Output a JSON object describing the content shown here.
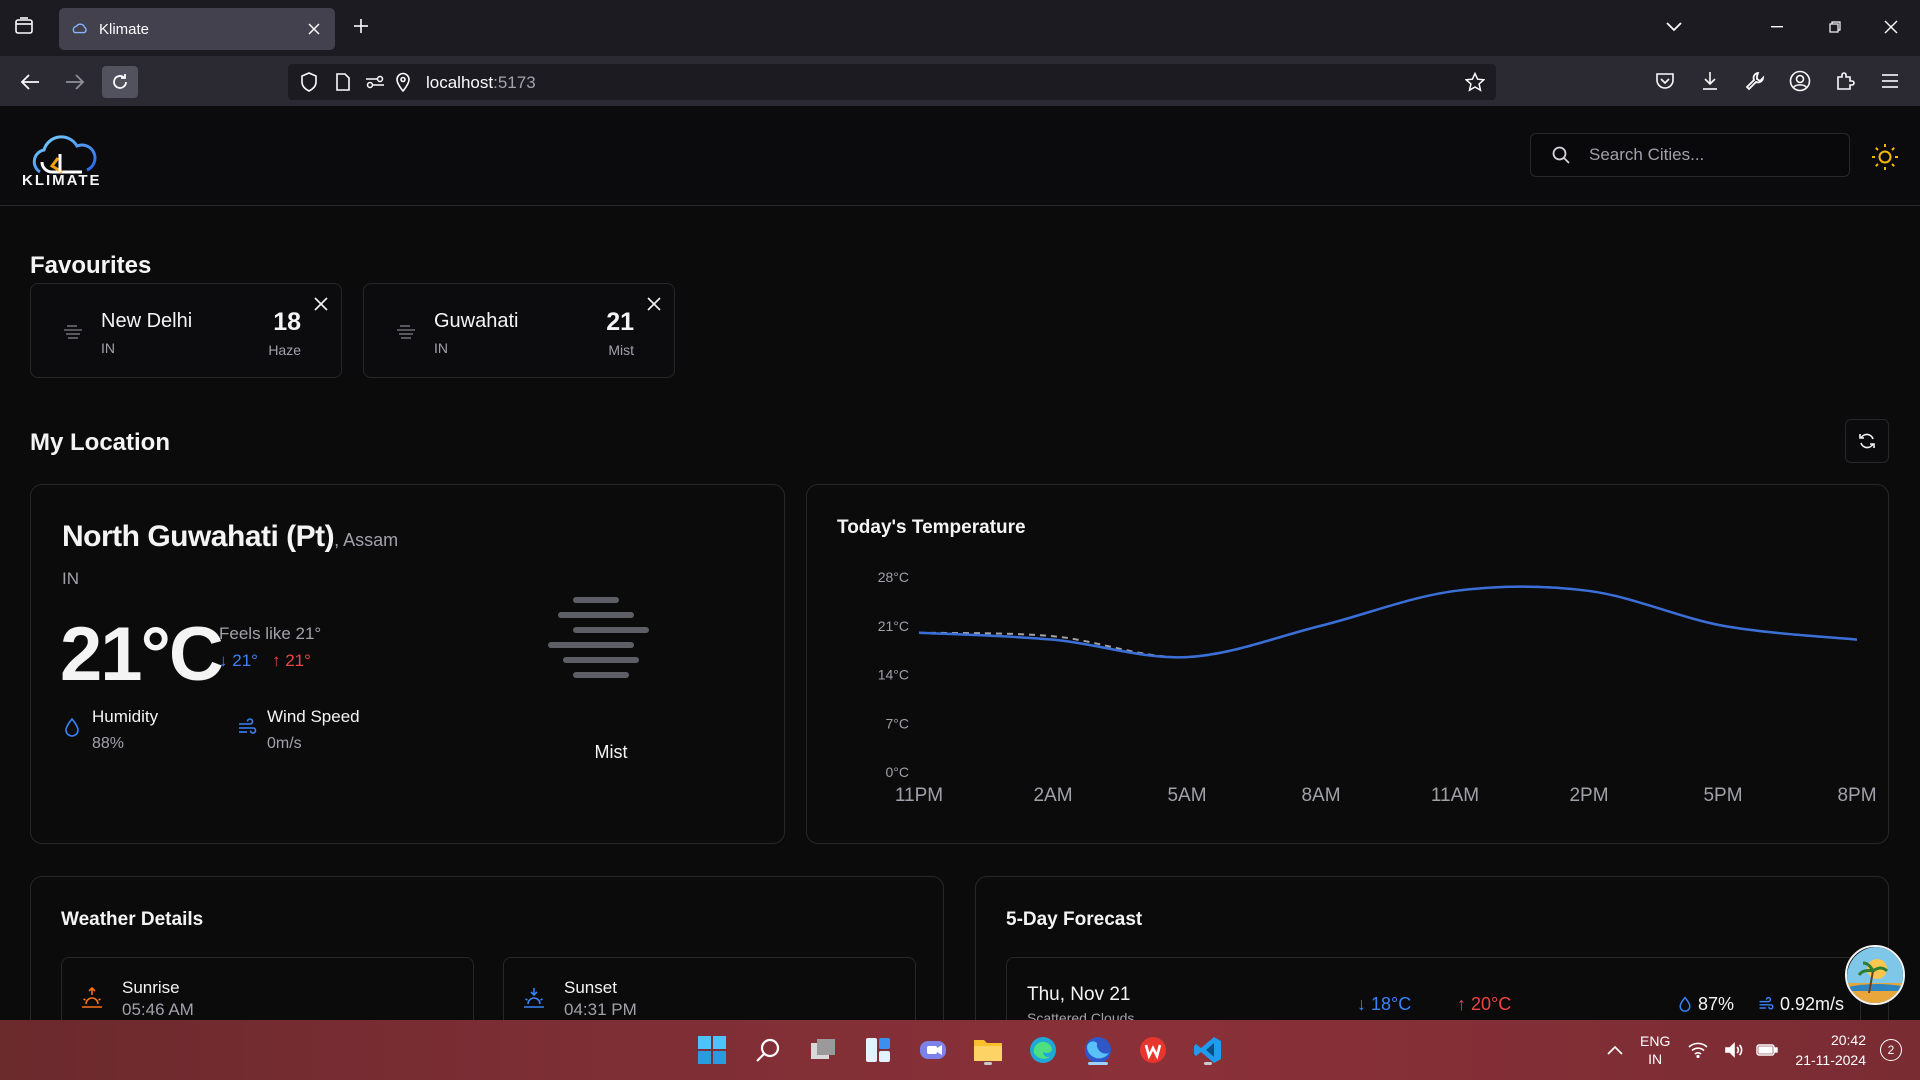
{
  "browser": {
    "tab_title": "Klimate",
    "url_host": "localhost",
    "url_port": ":5173"
  },
  "header": {
    "logo_text": "KLIMATE",
    "search_placeholder": "Search Cities..."
  },
  "favourites": {
    "title": "Favourites",
    "items": [
      {
        "name": "New Delhi",
        "country": "IN",
        "temp": "18",
        "desc": "Haze"
      },
      {
        "name": "Guwahati",
        "country": "IN",
        "temp": "21",
        "desc": "Mist"
      }
    ]
  },
  "location": {
    "title": "My Location",
    "city": "North Guwahati (Pt)",
    "state": ", Assam",
    "country": "IN",
    "temp": "21°C",
    "feels_like": "Feels like 21°",
    "min": "21°",
    "max": "21°",
    "humidity_label": "Humidity",
    "humidity_value": "88%",
    "wind_label": "Wind Speed",
    "wind_value": "0m/s",
    "condition": "Mist"
  },
  "chart_data": {
    "type": "line",
    "title": "Today's Temperature",
    "x": [
      "11PM",
      "2AM",
      "5AM",
      "8AM",
      "11AM",
      "2PM",
      "5PM",
      "8PM"
    ],
    "y_ticks": [
      "28°C",
      "21°C",
      "14°C",
      "7°C",
      "0°C"
    ],
    "ylim": [
      0,
      28
    ],
    "series": [
      {
        "values": [
          20,
          19,
          16.5,
          21,
          26,
          26,
          21,
          19
        ],
        "style": "solid",
        "color": "#3b6fd8"
      },
      {
        "values": [
          20,
          19.5,
          16.5,
          21,
          26,
          26,
          21,
          19
        ],
        "style": "dashed",
        "color": "#a1a1aa"
      }
    ]
  },
  "details": {
    "title": "Weather Details",
    "sunrise_label": "Sunrise",
    "sunrise_value": "05:46 AM",
    "sunset_label": "Sunset",
    "sunset_value": "04:31 PM"
  },
  "forecast": {
    "title": "5-Day Forecast",
    "rows": [
      {
        "date": "Thu, Nov 21",
        "desc": "Scattered Clouds",
        "min": "18°C",
        "max": "20°C",
        "humidity": "87%",
        "wind": "0.92m/s"
      }
    ]
  },
  "taskbar": {
    "lang_top": "ENG",
    "lang_bottom": "IN",
    "time": "20:42",
    "date": "21-11-2024",
    "notifications": "2"
  },
  "colors": {
    "accent_blue": "#3b82f6",
    "accent_red": "#ef4444",
    "sun_yellow": "#f5b800"
  }
}
